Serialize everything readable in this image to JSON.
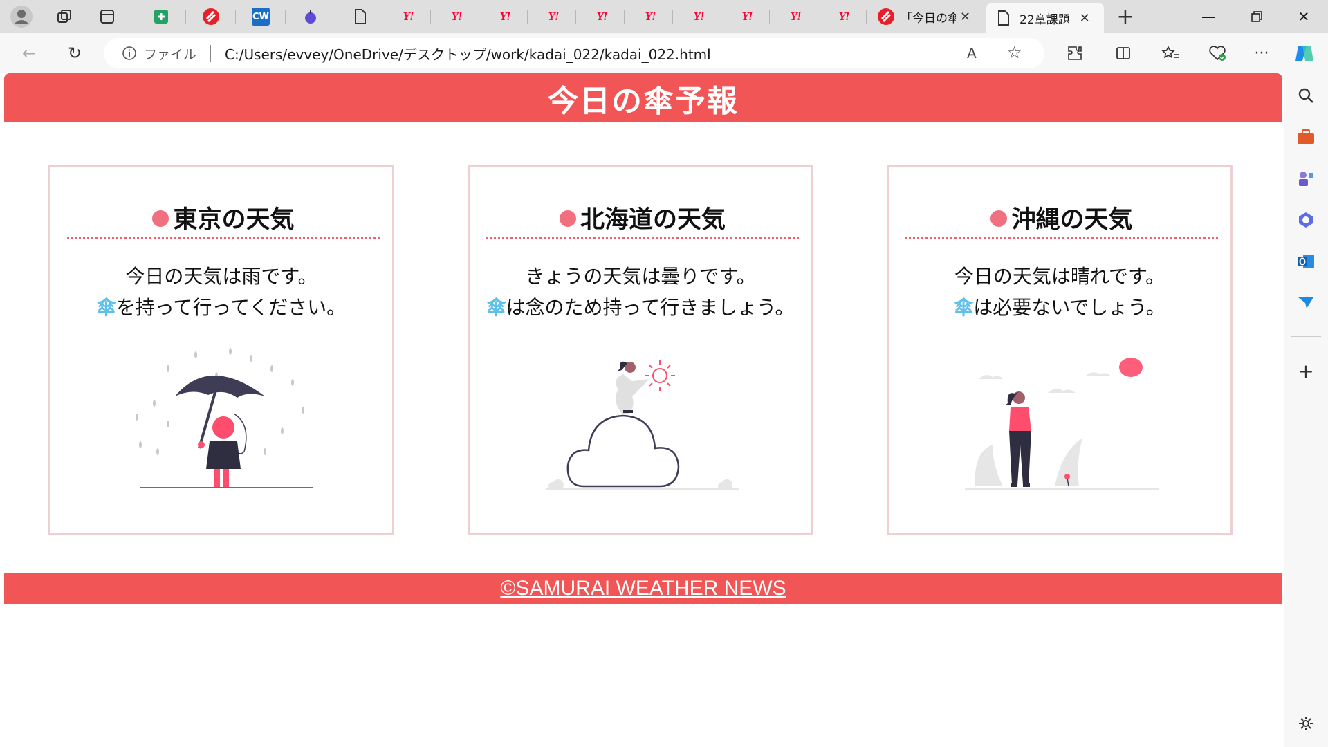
{
  "browser": {
    "tabs": [
      {
        "icon": "yahoo-icon",
        "label": "Y!"
      },
      {
        "icon": "yahoo-icon",
        "label": "Y!"
      },
      {
        "icon": "yahoo-icon",
        "label": "Y!"
      },
      {
        "icon": "yahoo-icon",
        "label": "Y!"
      },
      {
        "icon": "yahoo-icon",
        "label": "Y!"
      },
      {
        "icon": "yahoo-icon",
        "label": "Y!"
      },
      {
        "icon": "yahoo-icon",
        "label": "Y!"
      },
      {
        "icon": "yahoo-icon",
        "label": "Y!"
      },
      {
        "icon": "yahoo-icon",
        "label": "Y!"
      },
      {
        "icon": "yahoo-icon",
        "label": "Y!"
      }
    ],
    "cw_label": "CW",
    "samurai_tab_title": "「今日の傘",
    "active_tab_title": "22章課題",
    "address_label": "ファイル",
    "url": "C:/Users/evvey/OneDrive/デスクトップ/work/kadai_022/kadai_022.html"
  },
  "page": {
    "title": "今日の傘予報",
    "cards": [
      {
        "title": "東京の天気",
        "line1": "今日の天気は雨です。",
        "umbrella": "傘",
        "line2": "を持って行ってください。"
      },
      {
        "title": "北海道の天気",
        "line1": "きょうの天気は曇りです。",
        "umbrella": "傘",
        "line2": "は念のため持って行きましょう。"
      },
      {
        "title": "沖縄の天気",
        "line1": "今日の天気は晴れです。",
        "umbrella": "傘",
        "line2": "は必要ないでしょう。"
      }
    ],
    "footer": "©SAMURAI WEATHER NEWS"
  },
  "colors": {
    "header_red": "#f25555",
    "card_border": "#f0cfd2",
    "dot_pink": "#f07080",
    "umbrella_blue": "#5bc0eb"
  }
}
